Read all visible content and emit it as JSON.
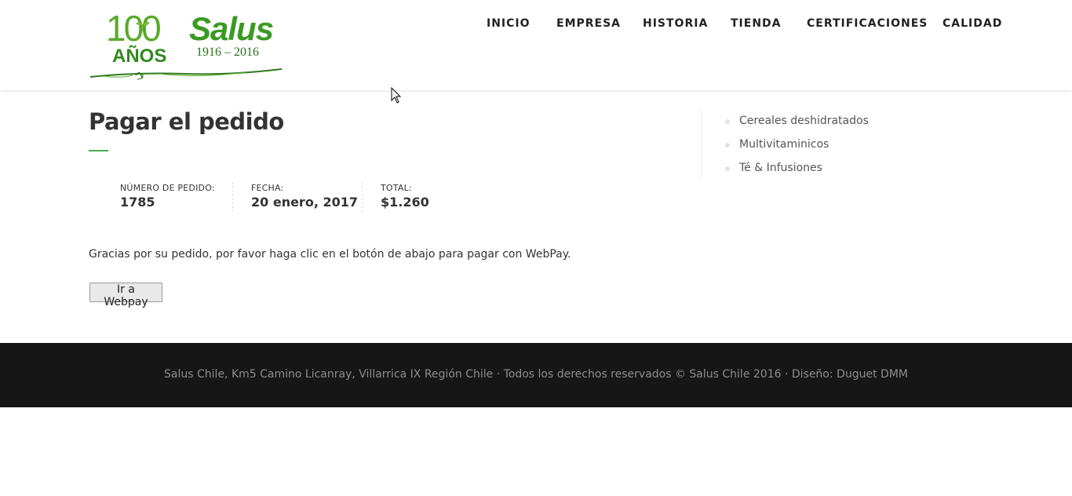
{
  "logo": {
    "anniversary": "100",
    "anos": "AÑOS",
    "brand": "Salus",
    "years": "1916 – 2016"
  },
  "nav": {
    "items": [
      {
        "label": "INICIO"
      },
      {
        "label": "EMPRESA"
      },
      {
        "label": "HISTORIA"
      },
      {
        "label": "TIENDA"
      },
      {
        "label": "CERTIFICACIONES"
      },
      {
        "label": "CALIDAD"
      }
    ]
  },
  "main": {
    "title": "Pagar el pedido",
    "order": {
      "number_label": "NÚMERO DE PEDIDO:",
      "number_value": "1785",
      "date_label": "FECHA:",
      "date_value": "20 enero, 2017",
      "total_label": "TOTAL:",
      "total_value": "$1.260"
    },
    "message": "Gracias por su pedido, por favor haga clic en el botón de abajo para pagar con WebPay.",
    "button_label": "Ir a Webpay"
  },
  "sidebar": {
    "categories": [
      {
        "label": "Cereales deshidratados"
      },
      {
        "label": "Multivitaminicos"
      },
      {
        "label": "Té & Infusiones"
      }
    ]
  },
  "footer": {
    "text": "Salus Chile, Km5 Camino Licanray, Villarrica IX Región Chile · Todos los derechos reservados © Salus Chile 2016 · Diseño: Duguet DMM"
  },
  "colors": {
    "accent": "#4caf50",
    "brand_green": "#3a9a23",
    "footer_bg": "#161616"
  }
}
